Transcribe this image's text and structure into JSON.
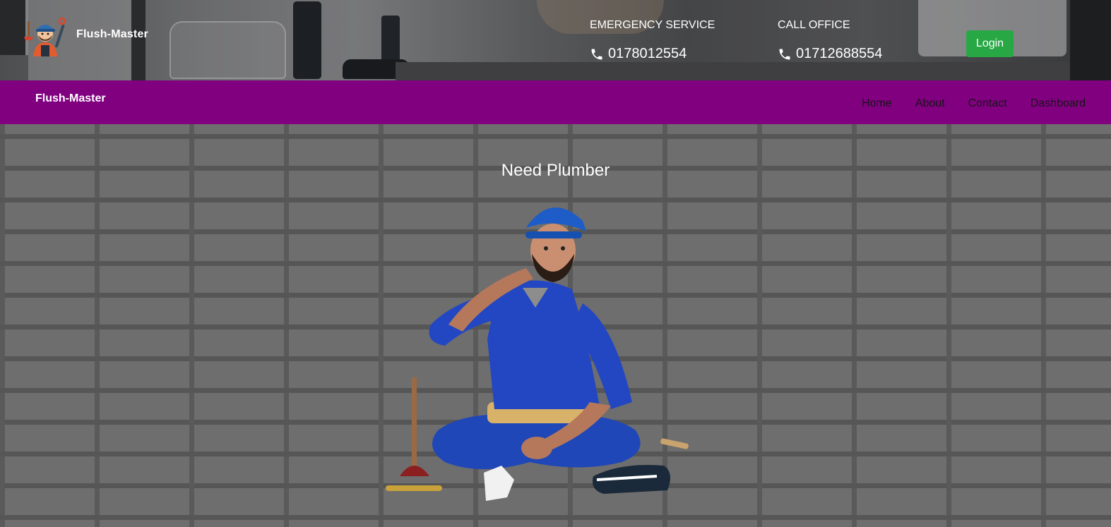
{
  "header": {
    "brand": "Flush-Master",
    "emergency": {
      "label": "EMERGENCY SERVICE",
      "phone": "0178012554"
    },
    "office": {
      "label": "CALL OFFICE",
      "phone": "01712688554"
    },
    "login_label": "Login"
  },
  "navbar": {
    "brand": "Flush-Master",
    "links": [
      "Home",
      "About",
      "Contact",
      "Dashboard"
    ]
  },
  "hero": {
    "title": "Need Plumber"
  },
  "colors": {
    "nav_background": "#800080",
    "login_button": "#28a745",
    "nav_link_text": "#161616"
  },
  "icons": [
    "plumber-logo-icon",
    "phone-icon"
  ]
}
